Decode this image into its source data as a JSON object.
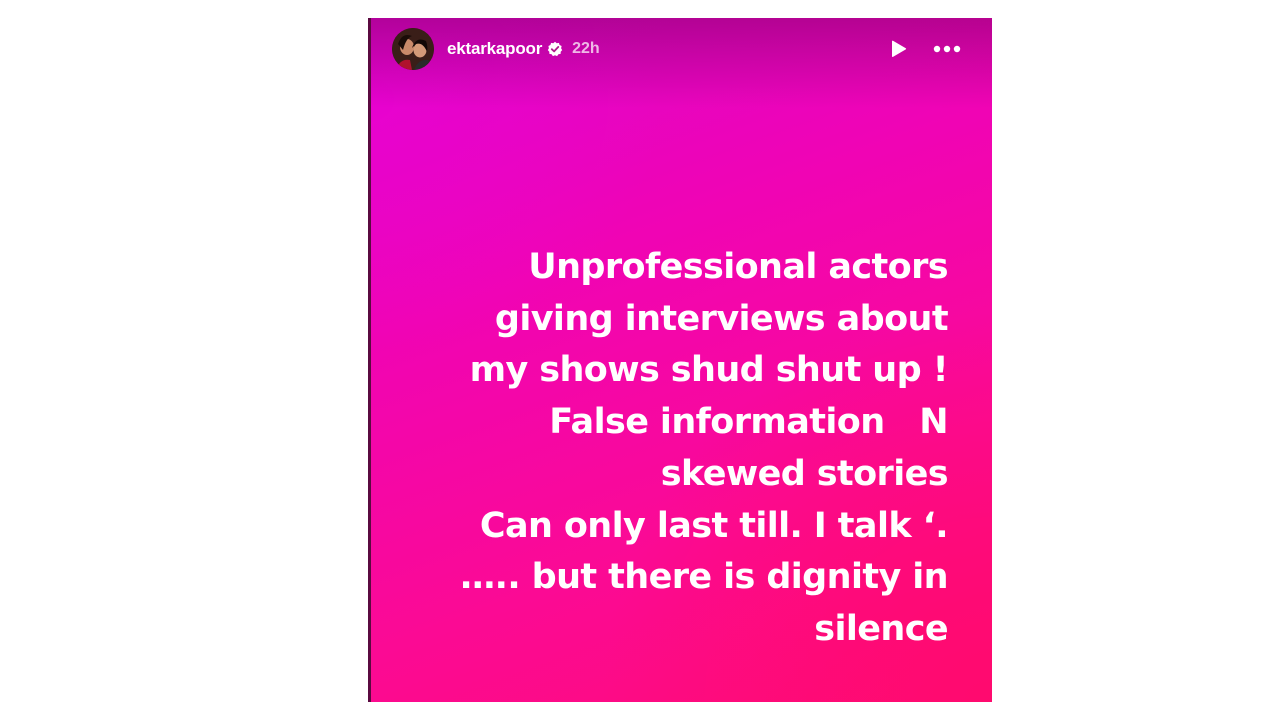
{
  "story": {
    "author": {
      "username": "ektarkapoor",
      "verified": true,
      "verified_icon": "verified-badge-icon",
      "avatar_icon": "profile-avatar"
    },
    "posted_ago": "22h",
    "controls": {
      "play_icon": "play-icon",
      "more_icon": "more-options-icon"
    },
    "background_colors": [
      "#dc06ce",
      "#f004b4",
      "#fb0a94",
      "#ff0c78"
    ],
    "text_lines": [
      "Unprofessional actors",
      "giving interviews about",
      "my shows shud shut up !",
      "False information   N",
      "skewed stories",
      "Can only last till. I talk ‘.",
      "….. but there is dignity in",
      "silence"
    ]
  }
}
